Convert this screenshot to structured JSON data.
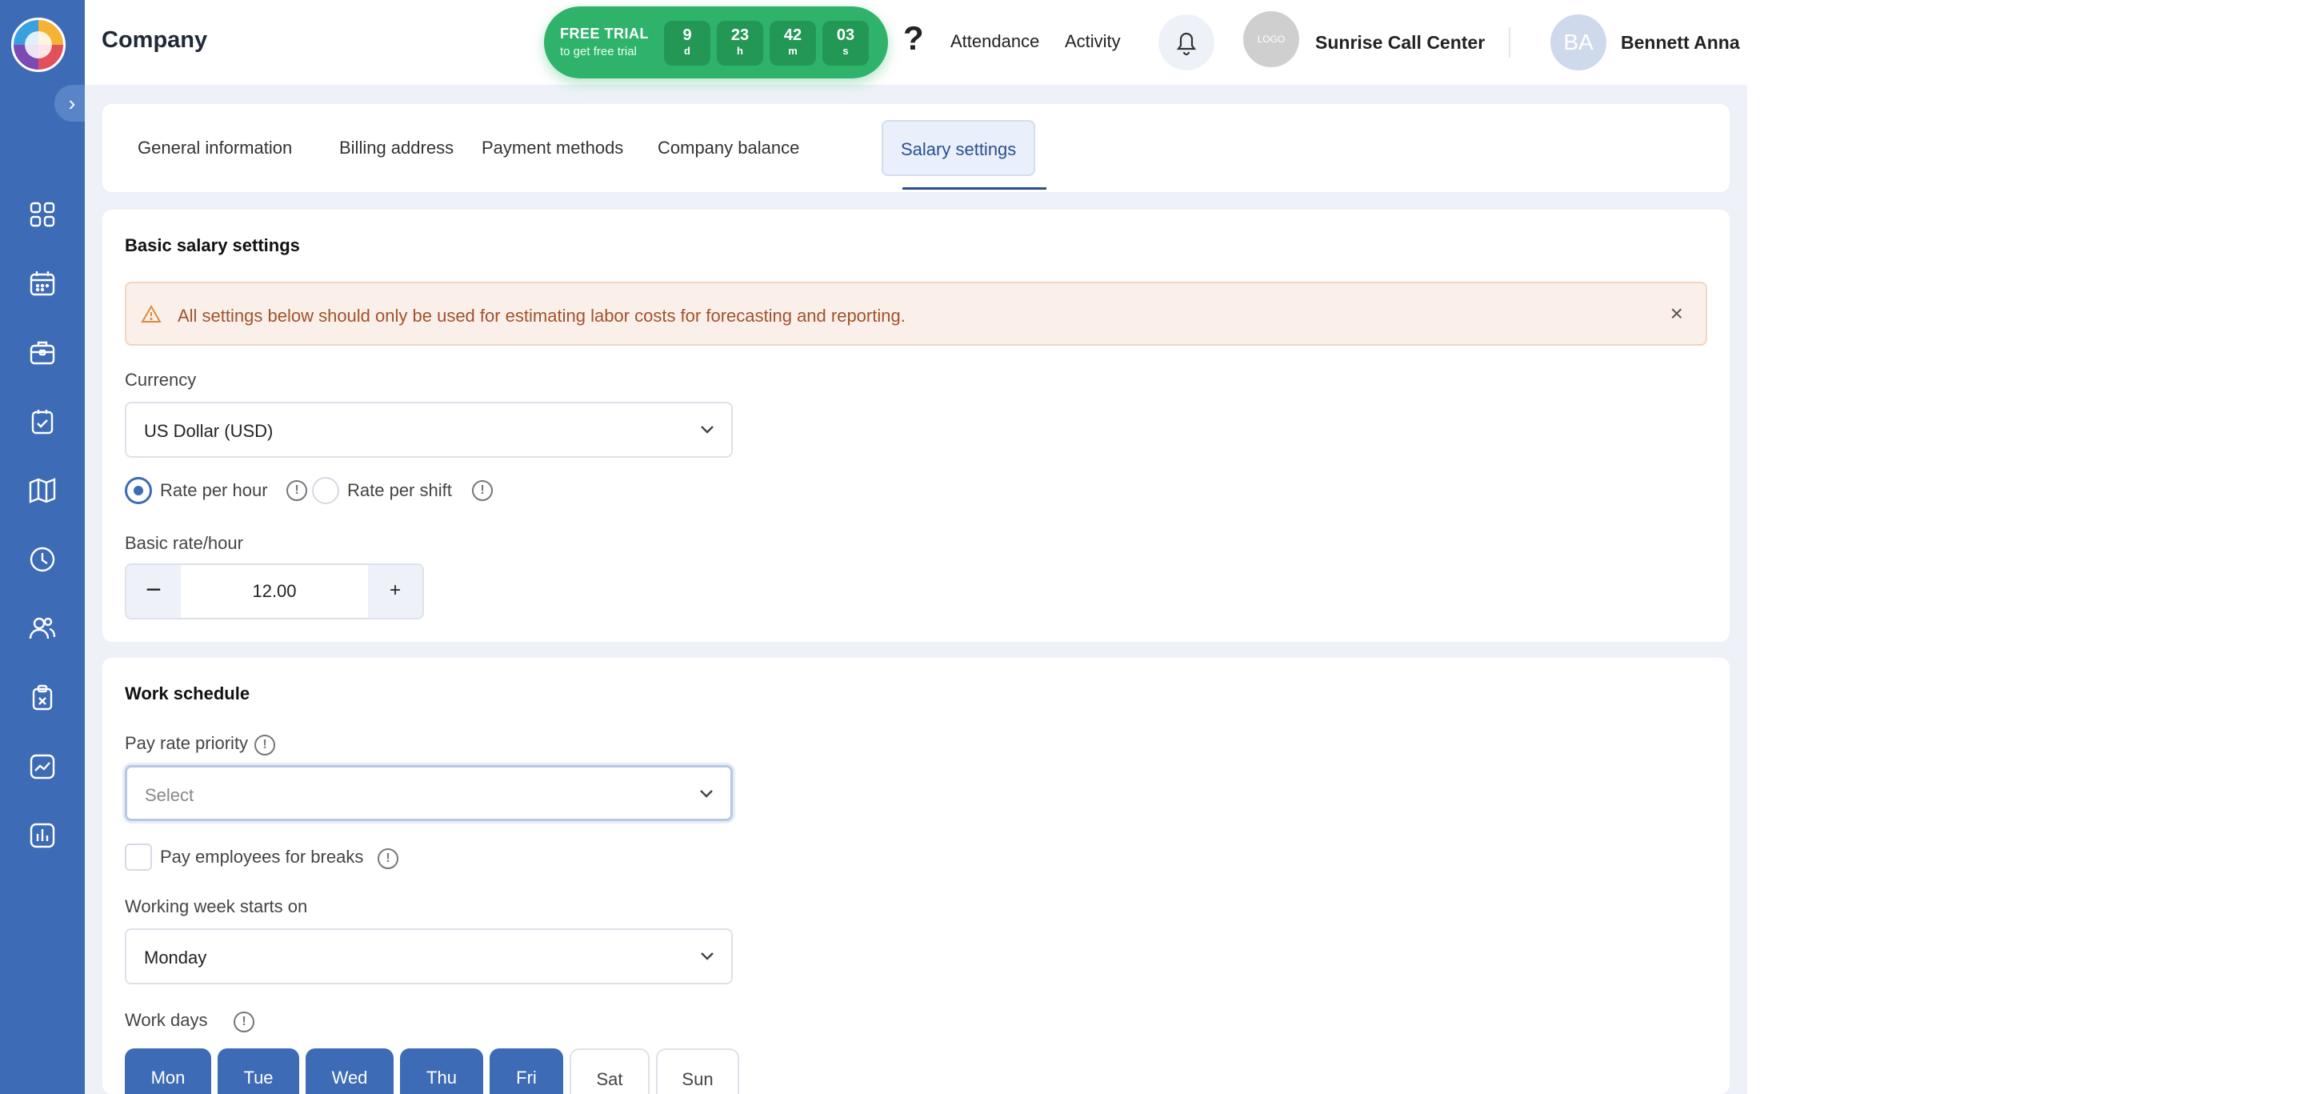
{
  "header": {
    "title": "Company",
    "trial": {
      "title": "FREE TRIAL",
      "subtitle": "to get free trial",
      "countdown": [
        {
          "value": "9",
          "unit": "d"
        },
        {
          "value": "23",
          "unit": "h"
        },
        {
          "value": "42",
          "unit": "m"
        },
        {
          "value": "03",
          "unit": "s"
        }
      ]
    },
    "help_label": "?",
    "nav": {
      "attendance": "Attendance",
      "activity": "Activity"
    },
    "company_logo_text": "LOGO",
    "company_name": "Sunrise Call Center",
    "user_initials": "BA",
    "user_name": "Bennett Anna"
  },
  "sidebar": {
    "collapse_glyph": "›",
    "icons": [
      "dashboard-icon",
      "calendar-icon",
      "briefcase-icon",
      "tasks-icon",
      "map-icon",
      "clock-icon",
      "users-icon",
      "clipboard-icon",
      "analytics-icon",
      "reports-icon"
    ]
  },
  "tabs": [
    {
      "label": "General information",
      "active": false
    },
    {
      "label": "Billing address",
      "active": false
    },
    {
      "label": "Payment methods",
      "active": false
    },
    {
      "label": "Company balance",
      "active": false
    },
    {
      "label": "Salary settings",
      "active": true
    }
  ],
  "basic": {
    "title": "Basic salary settings",
    "alert_text": "All settings below should only be used for estimating labor costs for forecasting and reporting.",
    "alert_close": "×",
    "currency_label": "Currency",
    "currency_value": "US Dollar (USD)",
    "rate_options": [
      {
        "label": "Rate per hour",
        "selected": true
      },
      {
        "label": "Rate per shift",
        "selected": false
      }
    ],
    "rate_label": "Basic rate/hour",
    "rate_value": "12.00",
    "minus": "−",
    "plus": "+"
  },
  "schedule": {
    "title": "Work schedule",
    "pay_rate_label": "Pay rate priority",
    "pay_rate_placeholder": "Select",
    "breaks_label": "Pay employees for breaks",
    "breaks_checked": false,
    "week_start_label": "Working week starts on",
    "week_start_value": "Monday",
    "work_days_label": "Work days",
    "days": [
      {
        "label": "Mon",
        "on": true
      },
      {
        "label": "Tue",
        "on": true
      },
      {
        "label": "Wed",
        "on": true
      },
      {
        "label": "Thu",
        "on": true
      },
      {
        "label": "Fri",
        "on": true
      },
      {
        "label": "Sat",
        "on": false
      },
      {
        "label": "Sun",
        "on": false
      }
    ],
    "info_glyph": "!"
  },
  "colors": {
    "sidebar": "#3e6bb5",
    "trial": "#2fb36a",
    "alert_bg": "#fbf0e9",
    "alert_text": "#a0522d",
    "active_tab": "#2a4f8e"
  }
}
